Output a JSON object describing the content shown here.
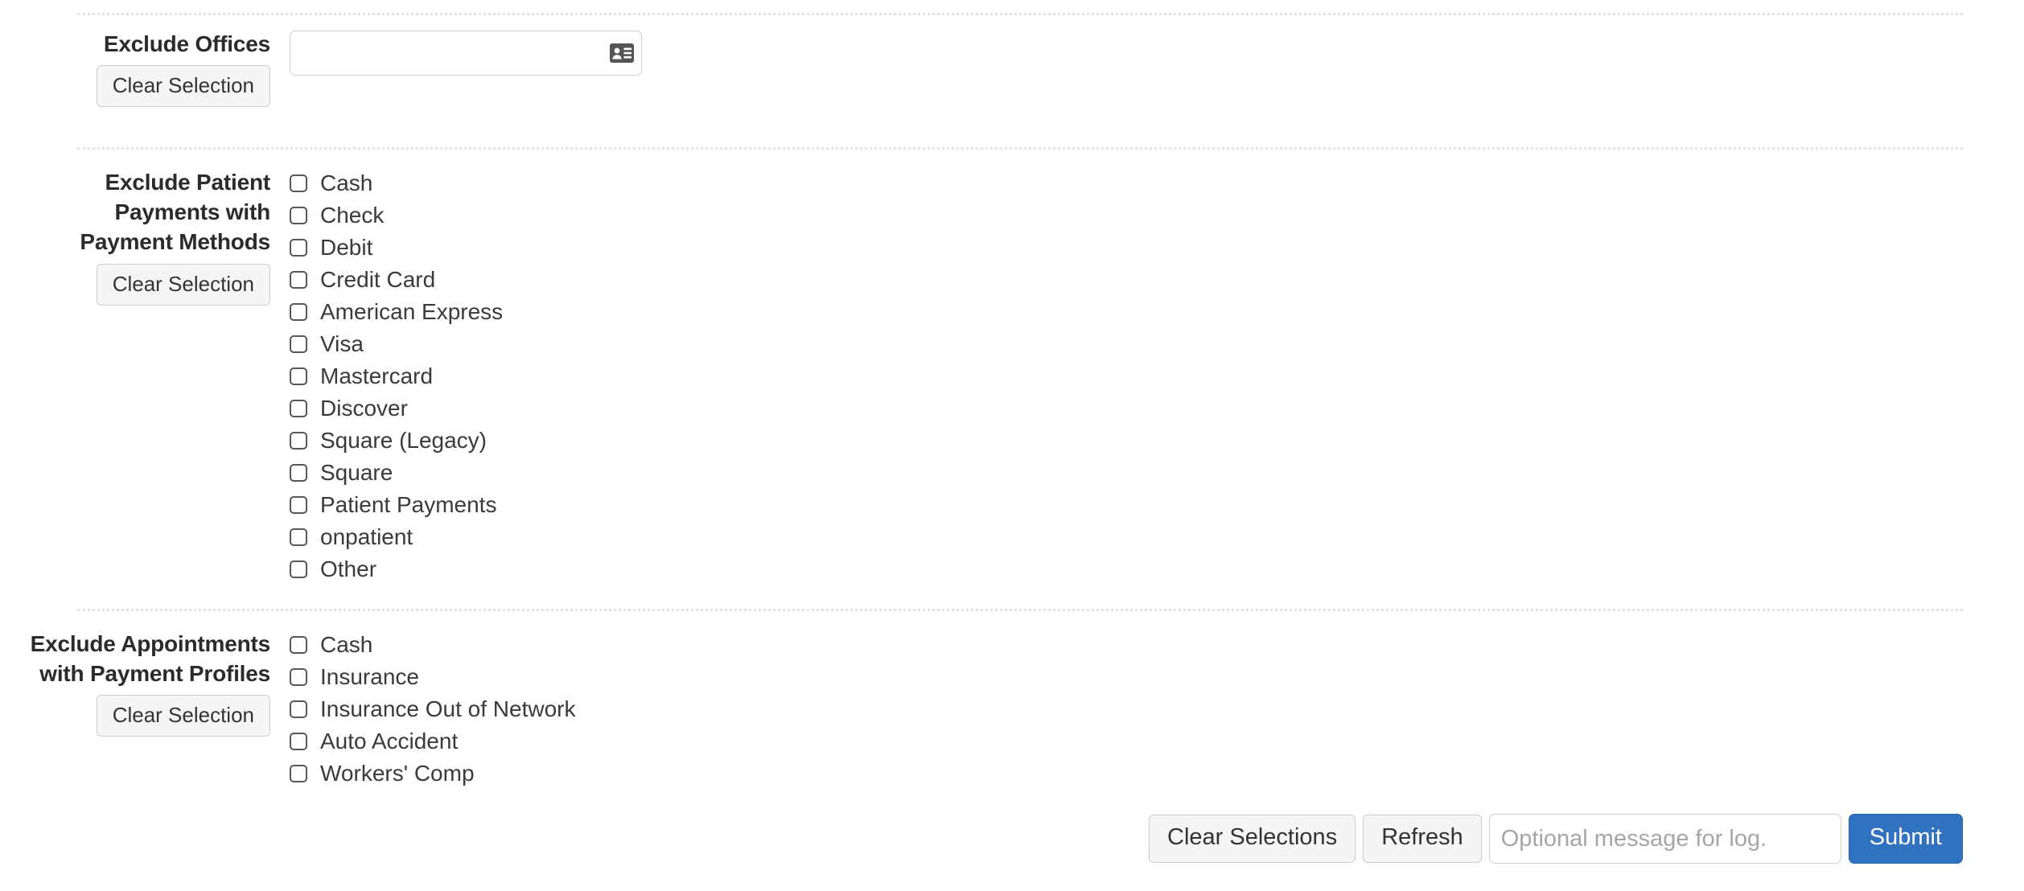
{
  "dividers": {
    "count": 3
  },
  "sections": [
    {
      "id": "exclude-offices",
      "label": "Exclude Offices",
      "clear_label": "Clear Selection",
      "control": "office-picker",
      "office_picker": {
        "value": "",
        "placeholder": "",
        "icon": "contact-card-icon"
      }
    },
    {
      "id": "exclude-patient-payments",
      "label": "Exclude Patient Payments with Payment Methods",
      "label_lines": [
        "Exclude Patient",
        "Payments with",
        "Payment Methods"
      ],
      "clear_label": "Clear Selection",
      "control": "checkbox-list",
      "options": [
        {
          "label": "Cash",
          "checked": false
        },
        {
          "label": "Check",
          "checked": false
        },
        {
          "label": "Debit",
          "checked": false
        },
        {
          "label": "Credit Card",
          "checked": false
        },
        {
          "label": "American Express",
          "checked": false
        },
        {
          "label": "Visa",
          "checked": false
        },
        {
          "label": "Mastercard",
          "checked": false
        },
        {
          "label": "Discover",
          "checked": false
        },
        {
          "label": "Square (Legacy)",
          "checked": false
        },
        {
          "label": "Square",
          "checked": false
        },
        {
          "label": "Patient Payments",
          "checked": false
        },
        {
          "label": "onpatient",
          "checked": false
        },
        {
          "label": "Other",
          "checked": false
        }
      ]
    },
    {
      "id": "exclude-appointments",
      "label": "Exclude Appointments with Payment Profiles",
      "label_lines": [
        "Exclude Appointments",
        "with Payment Profiles"
      ],
      "clear_label": "Clear Selection",
      "control": "checkbox-list",
      "options": [
        {
          "label": "Cash",
          "checked": false
        },
        {
          "label": "Insurance",
          "checked": false
        },
        {
          "label": "Insurance Out of Network",
          "checked": false
        },
        {
          "label": "Auto Accident",
          "checked": false
        },
        {
          "label": "Workers' Comp",
          "checked": false
        }
      ]
    }
  ],
  "action_bar": {
    "clear_selections_label": "Clear Selections",
    "refresh_label": "Refresh",
    "log_message": {
      "value": "",
      "placeholder": "Optional message for log."
    },
    "submit_label": "Submit"
  },
  "colors": {
    "primary": "#3071c0",
    "button_face": "#f5f5f5",
    "button_border": "#cccccc",
    "input_border": "#cfcfcf",
    "divider": "#e2e2e2",
    "text": "#333333",
    "placeholder": "#a6a6a6",
    "icon_dark": "#555555"
  }
}
